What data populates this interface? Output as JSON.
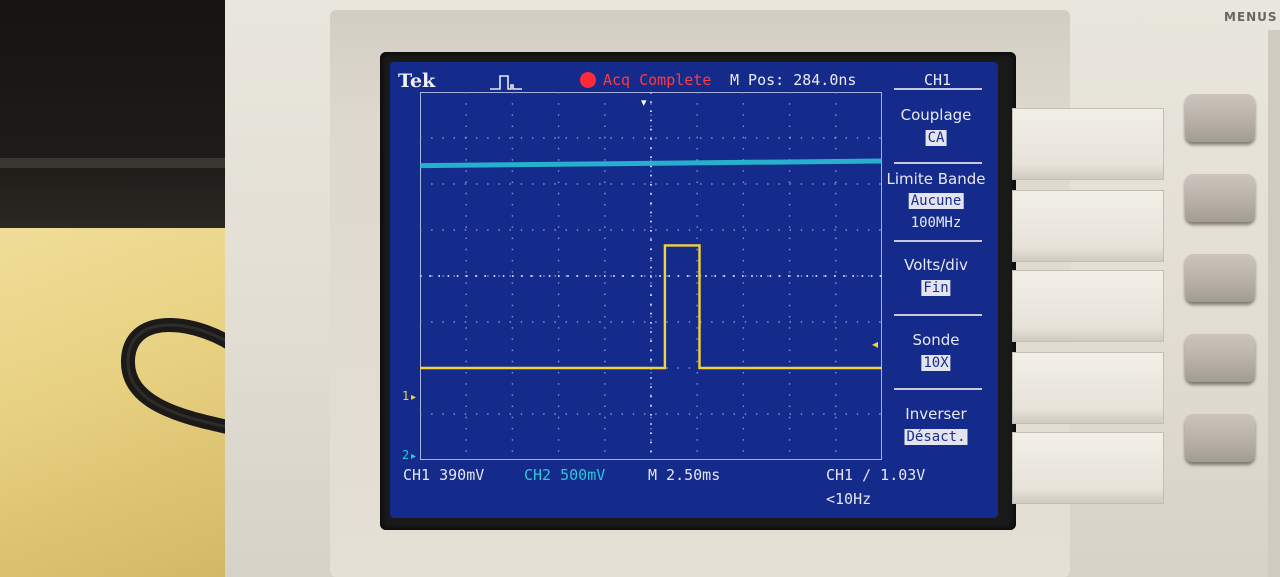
{
  "status_bar": {
    "brand": "Tek",
    "acquisition_status": "Acq Complete",
    "horizontal_position": "M Pos: 284.0ns",
    "menu_channel": "CH1"
  },
  "side_menu": {
    "items": [
      {
        "label": "Couplage",
        "value": "CA"
      },
      {
        "label": "Limite Bande",
        "value": "Aucune",
        "value_extra": "100MHz"
      },
      {
        "label": "Volts/div",
        "value": "Fin"
      },
      {
        "label": "Sonde",
        "value": "10X"
      },
      {
        "label": "Inverser",
        "value": "Désact."
      }
    ]
  },
  "markers": {
    "ch1_ground": "1",
    "ch2_ground": "2"
  },
  "readout": {
    "ch1_scale": "CH1  390mV",
    "ch2_scale": "CH2  500mV",
    "timebase": "M 2.50ms",
    "trigger": "CH1 ∕ 1.03V",
    "trigger_freq": "<10Hz"
  },
  "instrument": {
    "menus_button_label": "MENUS"
  },
  "colors": {
    "screen_bg": "#152b8c",
    "ch1_trace": "#f2d23c",
    "ch2_trace": "#2ac8d8",
    "acq_indicator": "#ff2a3a"
  },
  "chart_data": {
    "type": "line",
    "title": "",
    "xlabel": "",
    "ylabel": "",
    "x_unit": "ms",
    "grid": true,
    "divisions": {
      "x": 10,
      "y": 8
    },
    "series": [
      {
        "channel": "CH1",
        "color": "#f2d23c",
        "x": [
          0,
          5.3,
          5.3,
          6.05,
          6.05,
          10
        ],
        "y_div": [
          0,
          0,
          3.1,
          3.1,
          0,
          0
        ]
      },
      {
        "channel": "CH2",
        "color": "#2ac8d8",
        "x": [
          0,
          10
        ],
        "y_div": [
          6.4,
          6.5
        ]
      }
    ]
  }
}
